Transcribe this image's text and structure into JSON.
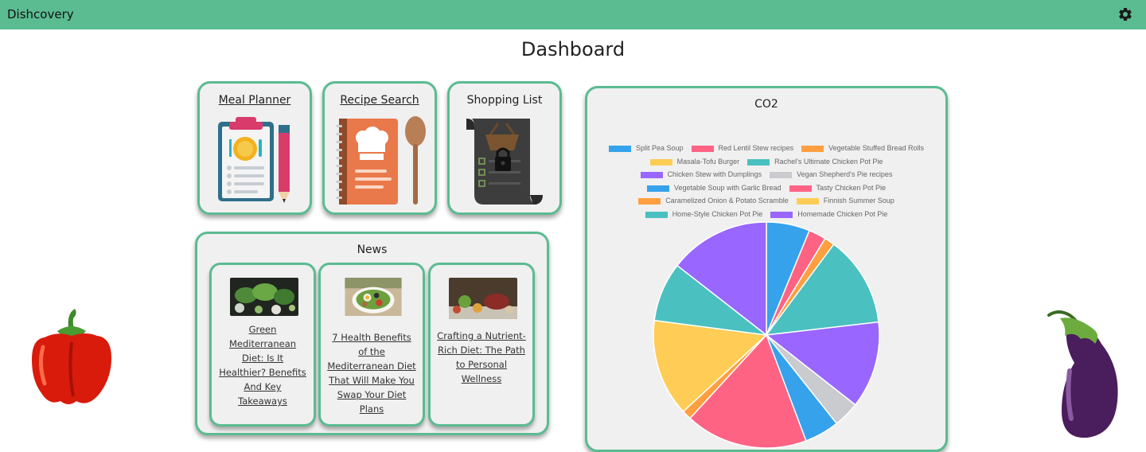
{
  "header": {
    "brand": "Dishcovery"
  },
  "page": {
    "title": "Dashboard"
  },
  "tiles": [
    {
      "label": "Meal Planner",
      "link": true
    },
    {
      "label": "Recipe Search",
      "link": true
    },
    {
      "label": "Shopping List",
      "link": false
    }
  ],
  "news": {
    "title": "News",
    "items": [
      {
        "title": "Green Mediterranean Diet: Is It Healthier? Benefits And Key Takeaways"
      },
      {
        "title": "7 Health Benefits of the Mediterranean Diet That Will Make You Swap Your Diet Plans"
      },
      {
        "title": "Crafting a Nutrient-Rich Diet: The Path to Personal Wellness"
      }
    ]
  },
  "chart_data": {
    "type": "pie",
    "title": "CO2",
    "legend_position": "top",
    "series": [
      {
        "name": "Split Pea Soup",
        "value": 5.5,
        "color": "#36a2eb"
      },
      {
        "name": "Red Lentil Stew recipes",
        "value": 2.2,
        "color": "#ff6384"
      },
      {
        "name": "Vegetable Stuffed Bread Rolls",
        "value": 1.3,
        "color": "#ff9f40"
      },
      {
        "name": "Masala-Tofu Burger",
        "value": 0,
        "color": "#ffcd56"
      },
      {
        "name": "Rachel's Ultimate Chicken Pot Pie",
        "value": 11.5,
        "color": "#4bc0c0"
      },
      {
        "name": "Chicken Stew with Dumplings",
        "value": 11.0,
        "color": "#9966ff"
      },
      {
        "name": "Vegan Shepherd's Pie recipes",
        "value": 3.3,
        "color": "#c9cbcf"
      },
      {
        "name": "Vegetable Soup with Garlic Bread",
        "value": 4.4,
        "color": "#36a2eb"
      },
      {
        "name": "Tasty Chicken Pot Pie",
        "value": 15.5,
        "color": "#ff6384"
      },
      {
        "name": "Caramelized Onion & Potato Scramble",
        "value": 1.2,
        "color": "#ff9f40"
      },
      {
        "name": "Finnish Summer Soup",
        "value": 12.3,
        "color": "#ffcd56"
      },
      {
        "name": "Home-Style Chicken Pot Pie",
        "value": 7.5,
        "color": "#4bc0c0"
      },
      {
        "name": "Homemade Chicken Pot Pie",
        "value": 12.8,
        "color": "#9966ff"
      }
    ]
  },
  "colors": {
    "brand": "#5bbb91",
    "card_bg": "#f0f0f0"
  }
}
